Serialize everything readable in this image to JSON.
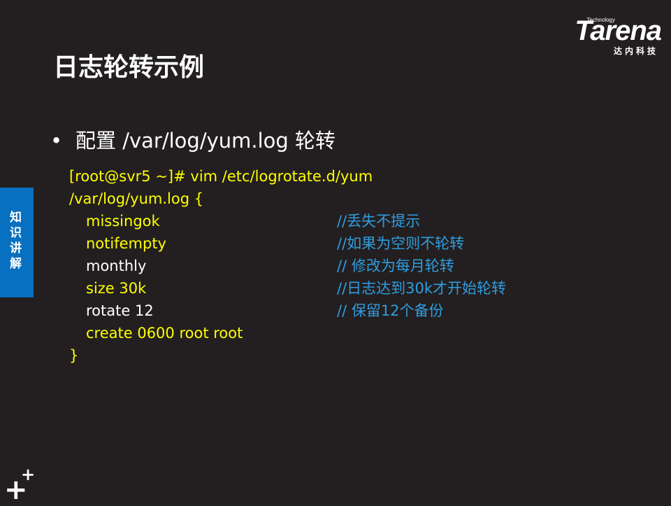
{
  "logo": {
    "tagline": "Technology",
    "wordmark": "Tarena",
    "chinese": "达内科技"
  },
  "title": "日志轮转示例",
  "bullet": {
    "marker": "•",
    "text": "配置 /var/log/yum.log 轮转"
  },
  "side_tab": {
    "text": "知识讲解"
  },
  "code": {
    "command": "[root@svr5 ~]# vim /etc/logrotate.d/yum",
    "open": "/var/log/yum.log {",
    "options": [
      {
        "text": "missingok",
        "color": "#ffff00"
      },
      {
        "text": "notifempty",
        "color": "#ffff00"
      },
      {
        "text": "monthly",
        "color": "#ffffff"
      },
      {
        "text": "size 30k",
        "color": "#ffff00"
      },
      {
        "text": "rotate  12",
        "color": "#ffffff"
      },
      {
        "text": "create 0600 root root",
        "color": "#ffff00"
      }
    ],
    "close": "}"
  },
  "comments": [
    "//丢失不提示",
    "//如果为空则不轮转",
    "// 修改为每月轮转",
    "//日志达到30k才开始轮转",
    "// 保留12个备份"
  ],
  "corner_mark": {
    "big": "+",
    "small": "+"
  },
  "colors": {
    "background": "#231f20",
    "accent_blue": "#0870c0",
    "comment_blue": "#2f9de0",
    "highlight_yellow": "#ffff00"
  }
}
